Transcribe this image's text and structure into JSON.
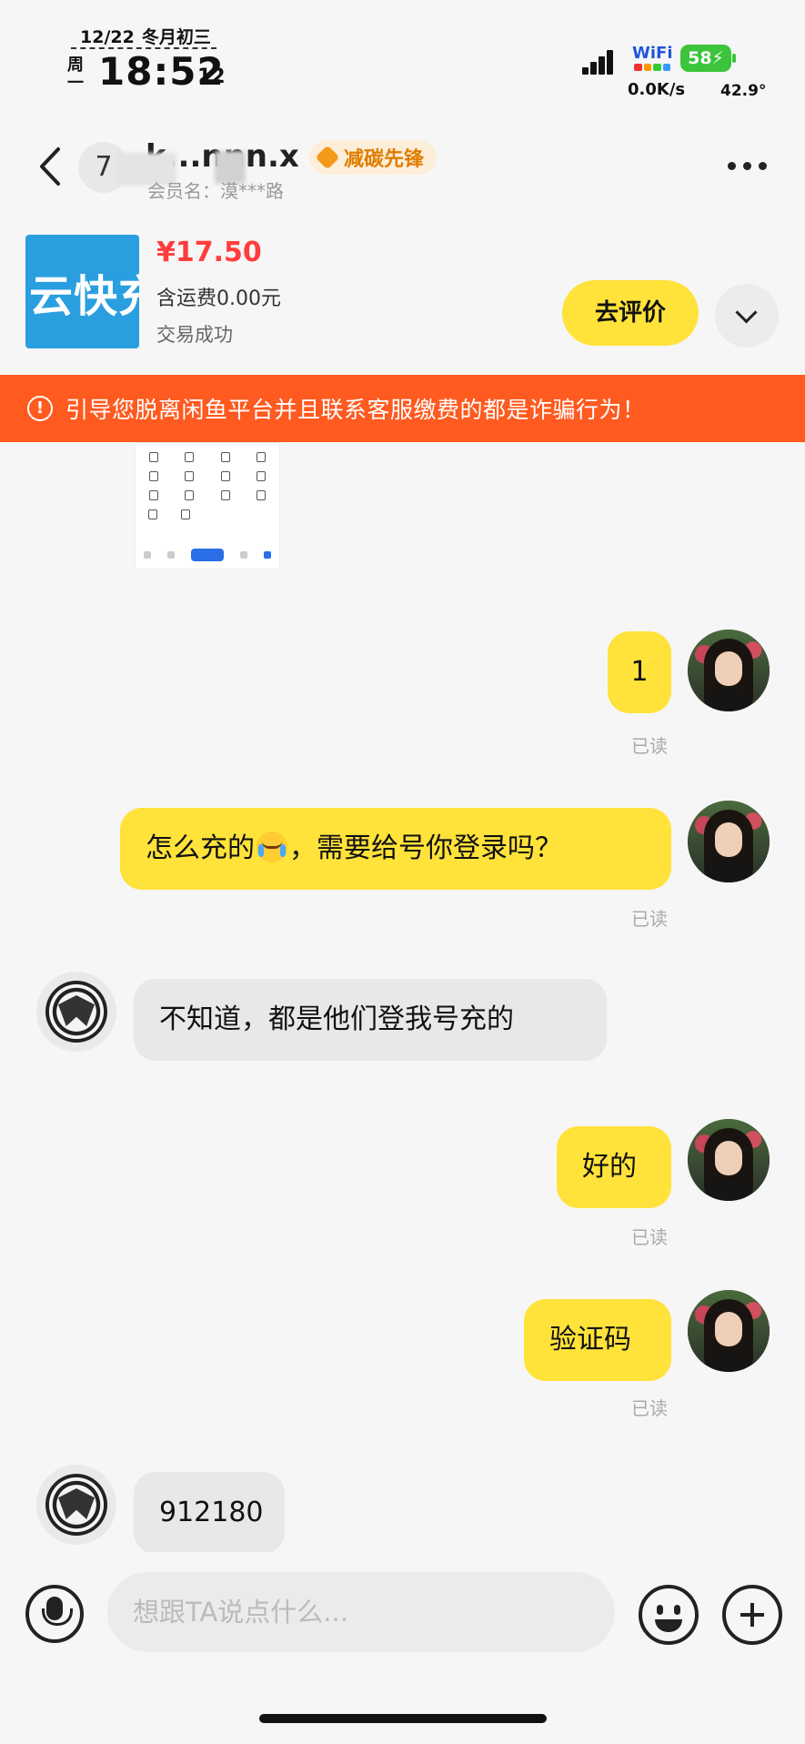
{
  "status_bar": {
    "date": "12/22",
    "lunar": "冬月初三",
    "weekday": "周一",
    "time": "18:52",
    "seconds": "12",
    "wifi_label": "WiFi",
    "battery": "58",
    "net_speed": "0.0K/s",
    "temperature": "42.9°"
  },
  "header": {
    "seller_avatar_char": "7",
    "seller_name": "k...nnn.x",
    "badge_label": "减碳先锋",
    "member_label": "会员名：漠***路"
  },
  "product": {
    "thumb_text": "云快充",
    "price": "¥17.50",
    "shipping": "含运费0.00元",
    "status": "交易成功",
    "review_button": "去评价"
  },
  "warning": {
    "text": "引导您脱离闲鱼平台并且联系客服缴费的都是诈骗行为！"
  },
  "messages": [
    {
      "sender": "me",
      "text": "1",
      "read": "已读"
    },
    {
      "sender": "me",
      "text_before": "怎么充的",
      "emoji": "crying-laughing",
      "text_after": "，需要给号你登录吗？",
      "read": "已读"
    },
    {
      "sender": "seller",
      "text": "不知道，都是他们登我号充的"
    },
    {
      "sender": "me",
      "text": "好的",
      "read": "已读"
    },
    {
      "sender": "me",
      "text": "验证码",
      "read": "已读"
    },
    {
      "sender": "seller",
      "text": "912180"
    }
  ],
  "input": {
    "placeholder": "想跟TA说点什么..."
  },
  "colors": {
    "accent_yellow": "#ffe23a",
    "warning_orange": "#ff5a1f",
    "price_red": "#ff3d3d",
    "badge_orange": "#e07d00"
  }
}
